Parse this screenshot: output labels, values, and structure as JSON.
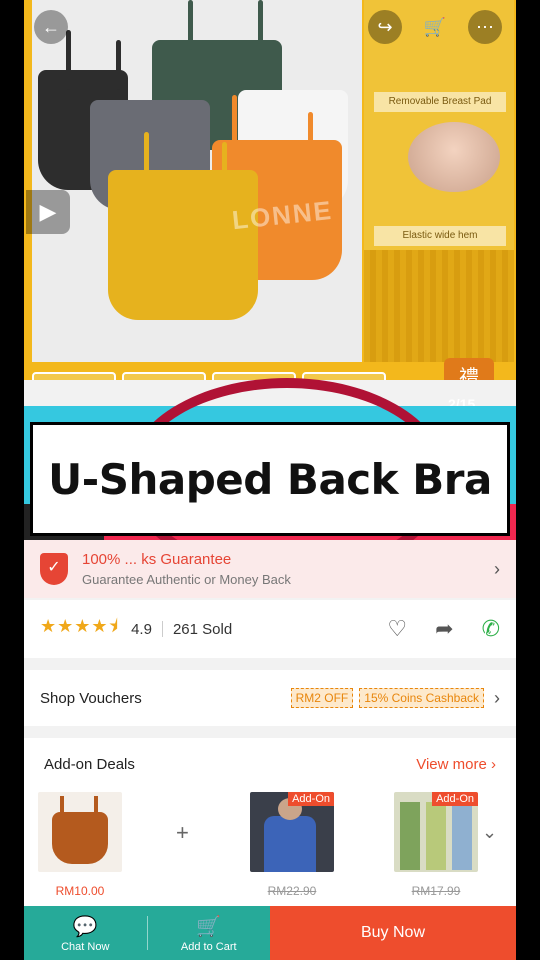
{
  "hero": {
    "side_label_1": "Removable Breast Pad",
    "side_label_2": "Elastic wide hem",
    "watermark": "LONNE",
    "image_counter": "2/15",
    "gift_glyph": "禮"
  },
  "banner": {
    "title": "U-Shaped Back Bra",
    "colors": {
      "cyan": "#35c8e0",
      "pink": "#f0284f",
      "ring": "#b01235"
    }
  },
  "guarantee": {
    "title": "100% ... ks Guarantee",
    "subtitle": "Guarantee Authentic or Money Back"
  },
  "rating": {
    "stars_display": "★★★★⯨",
    "score": "4.9",
    "sold": "261 Sold",
    "icons": [
      "heart-icon",
      "share-icon",
      "whatsapp-icon"
    ]
  },
  "vouchers": {
    "label": "Shop Vouchers",
    "tags": [
      "RM2 OFF",
      "15% Coins Cashback"
    ]
  },
  "addon": {
    "title": "Add-on Deals",
    "more": "View more",
    "items": [
      {
        "price": "RM10.00",
        "badge": ""
      },
      {
        "price": "RM22.90",
        "badge": "Add-On"
      },
      {
        "price": "RM17.99",
        "badge": "Add-On"
      }
    ]
  },
  "bottom_bar": {
    "chat": "Chat Now",
    "cart": "Add to Cart",
    "buy": "Buy Now"
  },
  "accent_colors": {
    "shopee_orange": "#ee4d2d",
    "shopee_green": "#26aa99"
  }
}
